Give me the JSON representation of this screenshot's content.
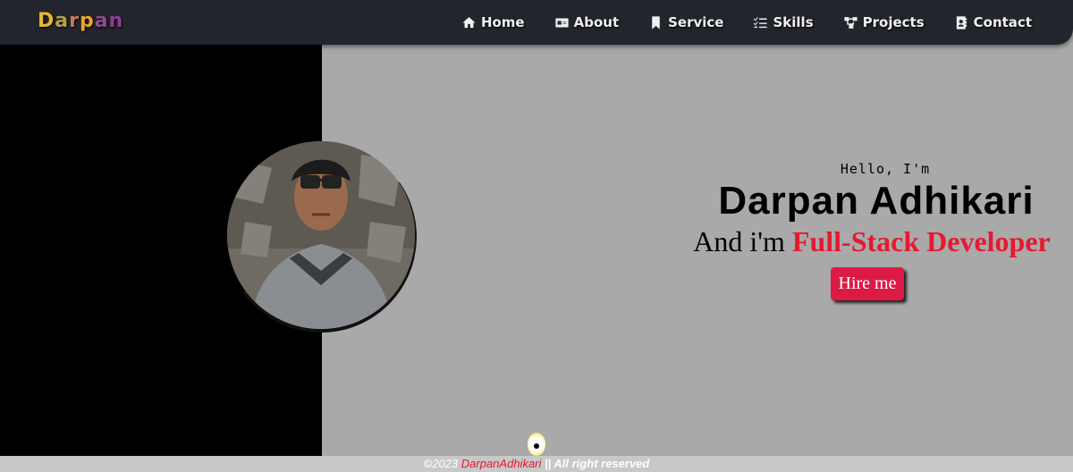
{
  "logo": {
    "letters": [
      "D",
      "a",
      "r",
      "p",
      "a",
      "n"
    ]
  },
  "nav": {
    "items": [
      {
        "label": "Home",
        "icon": "home-icon"
      },
      {
        "label": "About",
        "icon": "id-card-icon"
      },
      {
        "label": "Service",
        "icon": "bookmark-icon"
      },
      {
        "label": "Skills",
        "icon": "checklist-icon"
      },
      {
        "label": "Projects",
        "icon": "sitemap-icon"
      },
      {
        "label": "Contact",
        "icon": "address-book-icon"
      }
    ]
  },
  "hero": {
    "greeting": "Hello, I'm",
    "name": "Darpan Adhikari",
    "role_prefix": "And i'm",
    "role": "Full-Stack Developer",
    "cta": "Hire me"
  },
  "footer": {
    "year": "2023",
    "brand": "DarpanAdhikari",
    "rights": "|| All right reserved"
  },
  "colors": {
    "accent": "#e8182f",
    "button": "#dc1a45",
    "navbar": "#23252d",
    "background": "#a9a9a9"
  }
}
